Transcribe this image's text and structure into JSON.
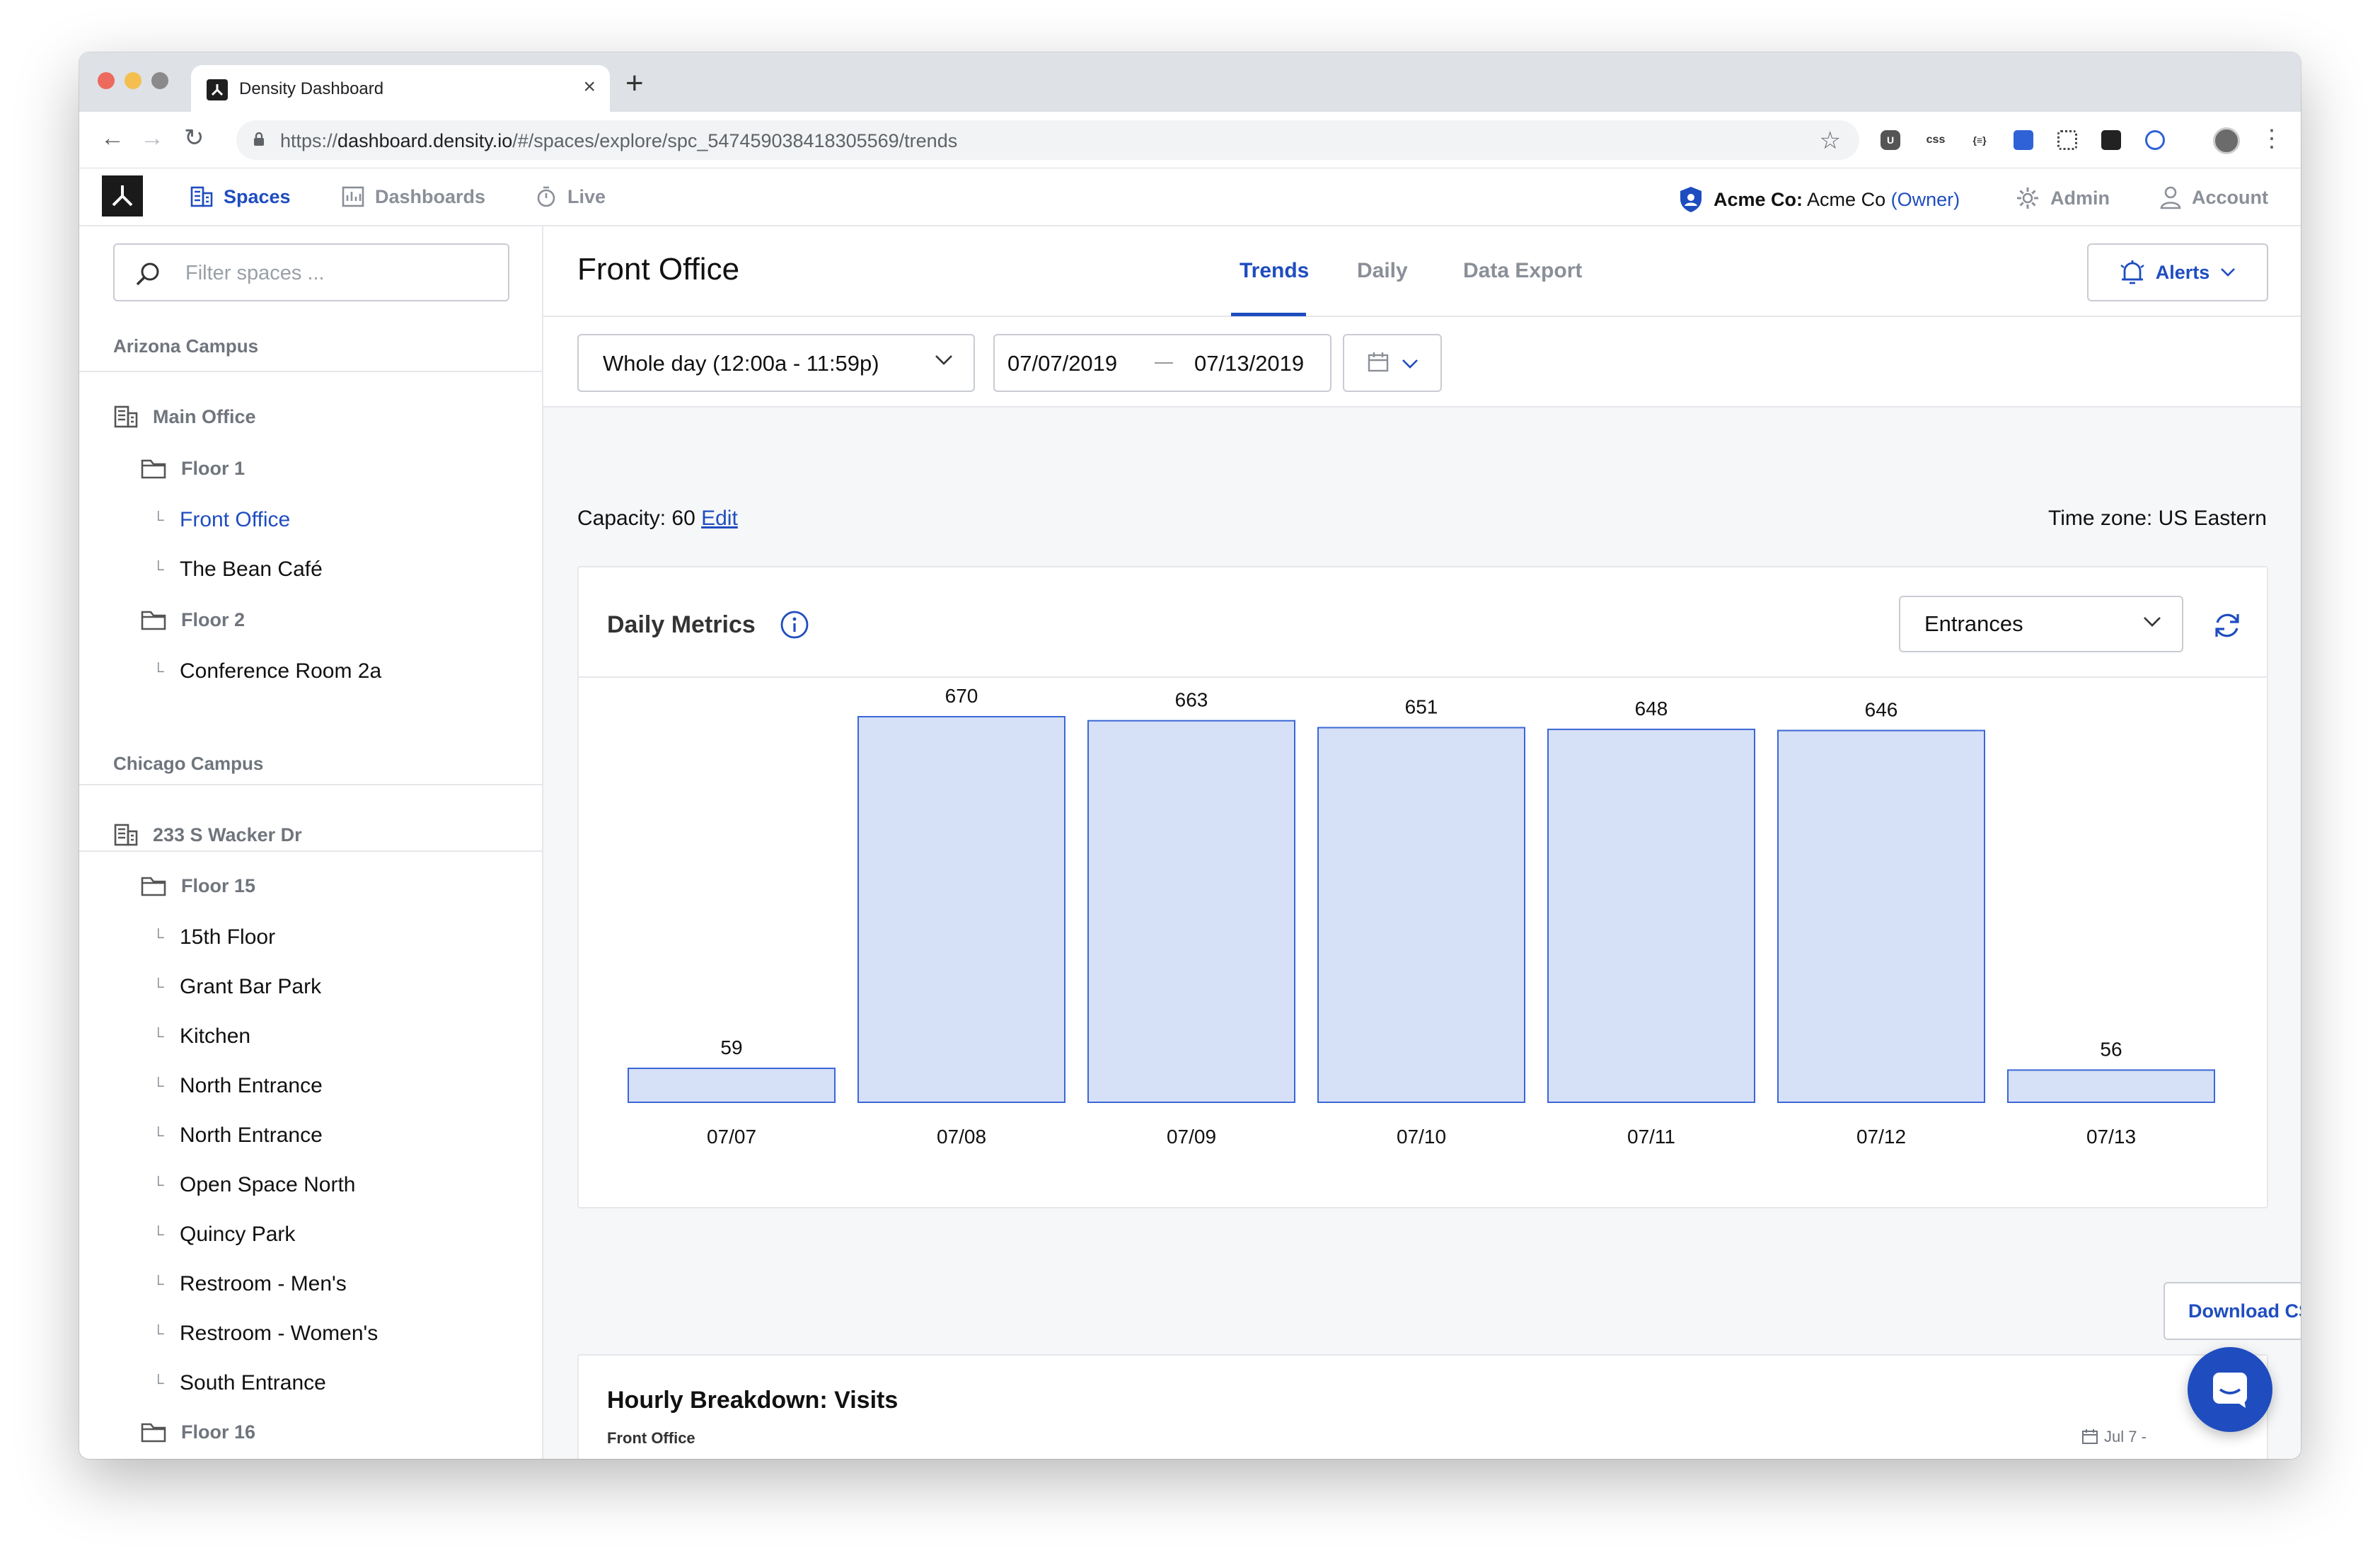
{
  "browser": {
    "tab_title": "Density Dashboard",
    "tab_close": "×",
    "new_tab": "+",
    "url_scheme": "https://",
    "url_host": "dashboard.density.io",
    "url_path": "/#/spaces/explore/spc_547459038418305569/trends",
    "ext_css": "css",
    "ext_json": "{≡}"
  },
  "app": {
    "nav": {
      "spaces": "Spaces",
      "dashboards": "Dashboards",
      "live": "Live",
      "org_label": "Acme Co:",
      "org_name": "Acme Co",
      "org_role": "(Owner)",
      "admin": "Admin",
      "account": "Account"
    },
    "accent_color": "#1f4dbf"
  },
  "sidebar": {
    "filter_placeholder": "Filter spaces ...",
    "groups": [
      {
        "title": "Arizona Campus",
        "items": [
          {
            "type": "building",
            "label": "Main Office"
          },
          {
            "type": "floor",
            "label": "Floor 1"
          },
          {
            "type": "space",
            "label": "Front Office",
            "selected": true
          },
          {
            "type": "space",
            "label": "The Bean Café"
          },
          {
            "type": "floor",
            "label": "Floor 2"
          },
          {
            "type": "space",
            "label": "Conference Room 2a"
          }
        ]
      },
      {
        "title": "Chicago Campus",
        "items": [
          {
            "type": "building",
            "label": "233 S Wacker Dr"
          },
          {
            "type": "floor",
            "label": "Floor 15"
          },
          {
            "type": "space",
            "label": "15th Floor"
          },
          {
            "type": "space",
            "label": "Grant Bar Park"
          },
          {
            "type": "space",
            "label": "Kitchen"
          },
          {
            "type": "space",
            "label": "North Entrance"
          },
          {
            "type": "space",
            "label": "North Entrance"
          },
          {
            "type": "space",
            "label": "Open Space North"
          },
          {
            "type": "space",
            "label": "Quincy Park"
          },
          {
            "type": "space",
            "label": "Restroom - Men's"
          },
          {
            "type": "space",
            "label": "Restroom - Women's"
          },
          {
            "type": "space",
            "label": "South Entrance"
          },
          {
            "type": "floor",
            "label": "Floor 16"
          }
        ]
      }
    ]
  },
  "main": {
    "title": "Front Office",
    "tabs": [
      "Trends",
      "Daily",
      "Data Export"
    ],
    "active_tab": "Trends",
    "alerts_label": "Alerts",
    "time_select": "Whole day (12:00a - 11:59p)",
    "start_date": "07/07/2019",
    "end_date": "07/13/2019",
    "capacity_label": "Capacity: 60",
    "capacity_edit": "Edit",
    "timezone": "Time zone: US Eastern",
    "daily_metrics": {
      "title": "Daily Metrics",
      "metric": "Entrances"
    },
    "download_csv": "Download CSV",
    "hourly": {
      "title": "Hourly Breakdown: Visits",
      "subtitle": "Front Office",
      "date": "Jul 7 -"
    }
  },
  "chart_data": {
    "type": "bar",
    "categories": [
      "07/07",
      "07/08",
      "07/09",
      "07/10",
      "07/11",
      "07/12",
      "07/13"
    ],
    "values": [
      59,
      670,
      663,
      651,
      648,
      646,
      56
    ],
    "ylim": [
      0,
      670
    ],
    "grid": false,
    "bar_fill": "#d6e0f7",
    "bar_stroke": "#3b67d6"
  }
}
